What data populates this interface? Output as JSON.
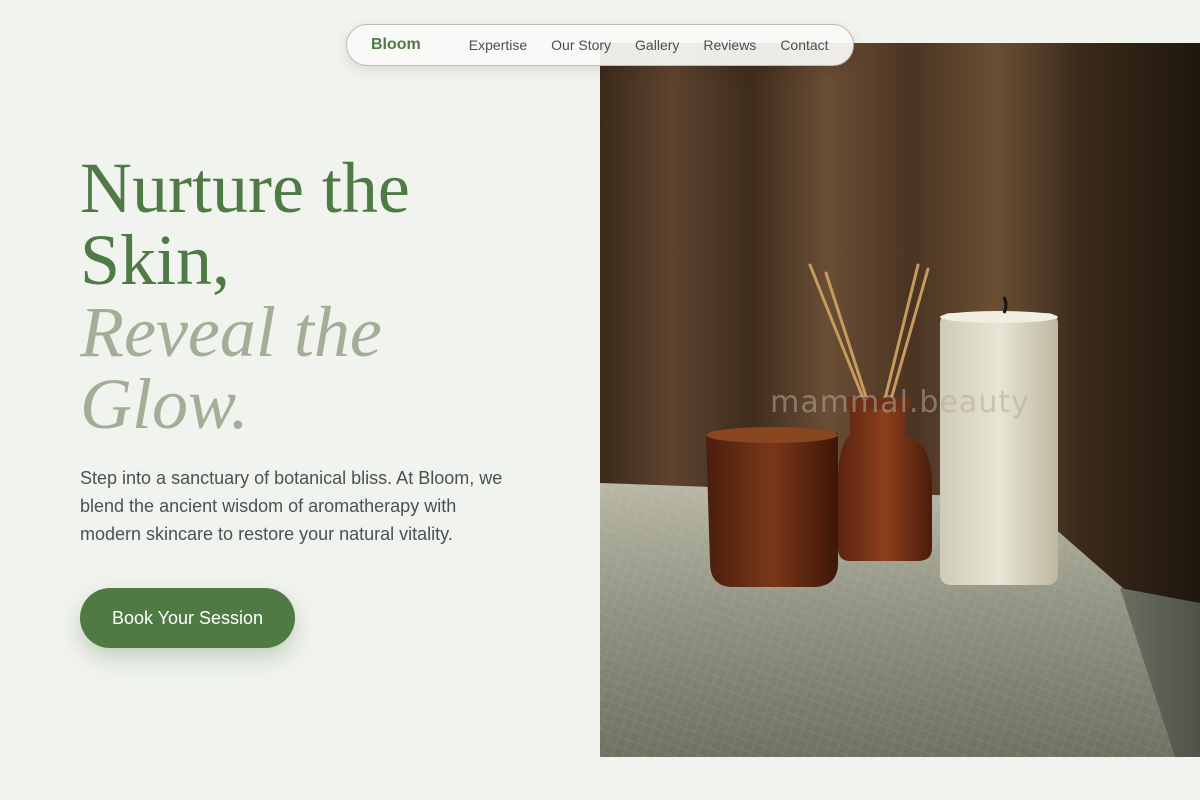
{
  "nav": {
    "brand": "Bloom",
    "links": [
      "Expertise",
      "Our Story",
      "Gallery",
      "Reviews",
      "Contact"
    ]
  },
  "hero": {
    "title_line1": "Nurture the",
    "title_line2": "Skin,",
    "accent_line1": "Reveal the",
    "accent_line2": "Glow.",
    "description": "Step into a sanctuary of botanical bliss. At Bloom, we blend the ancient wisdom of aromatherapy with modern skincare to restore your natural vitality.",
    "cta_label": "Book Your Session"
  },
  "photo": {
    "watermark": "mammal.beauty"
  },
  "colors": {
    "brand_green": "#4f7a45",
    "accent_sage": "#a4ad95",
    "background": "#f1f3ee",
    "body_text": "#4a5255"
  }
}
